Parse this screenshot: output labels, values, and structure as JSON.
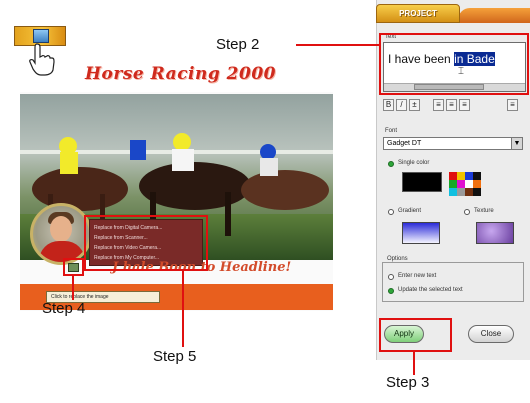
{
  "project_tab": {
    "label": "PROJECT"
  },
  "canvas": {
    "headline": "Horse Racing 2000",
    "caption": "J hale Boon to Headline!",
    "tooltip": "Click to replace the image",
    "context_menu": [
      "Replace from Digital Camera...",
      "Replace from Scanner...",
      "Replace from Video Camera...",
      "Replace from My Computer..."
    ]
  },
  "text_panel": {
    "text_label": "Text",
    "value_plain": "I have been ",
    "value_selected": "in Bade",
    "font_label": "Font",
    "font_value": "Gadget DT",
    "single_color_label": "Single color",
    "gradient_label": "Gradient",
    "texture_label": "Texture",
    "options_label": "Options",
    "option_enter": "Enter new text",
    "option_update": "Update the selected text",
    "apply_label": "Apply",
    "close_label": "Close"
  },
  "steps": {
    "step2": "Step 2",
    "step3": "Step 3",
    "step4": "Step 4",
    "step5": "Step 5"
  },
  "palette": [
    "#e01010",
    "#f0c400",
    "#1a3bd8",
    "#111111",
    "#18a828",
    "#e010d0",
    "#ffffff",
    "#f07010",
    "#10c0e0",
    "#9a9a9a",
    "#703010",
    "#111111"
  ],
  "colors": {
    "accent": "#e01010",
    "headline": "#cf2a1d",
    "banner": "#e85f1e"
  }
}
